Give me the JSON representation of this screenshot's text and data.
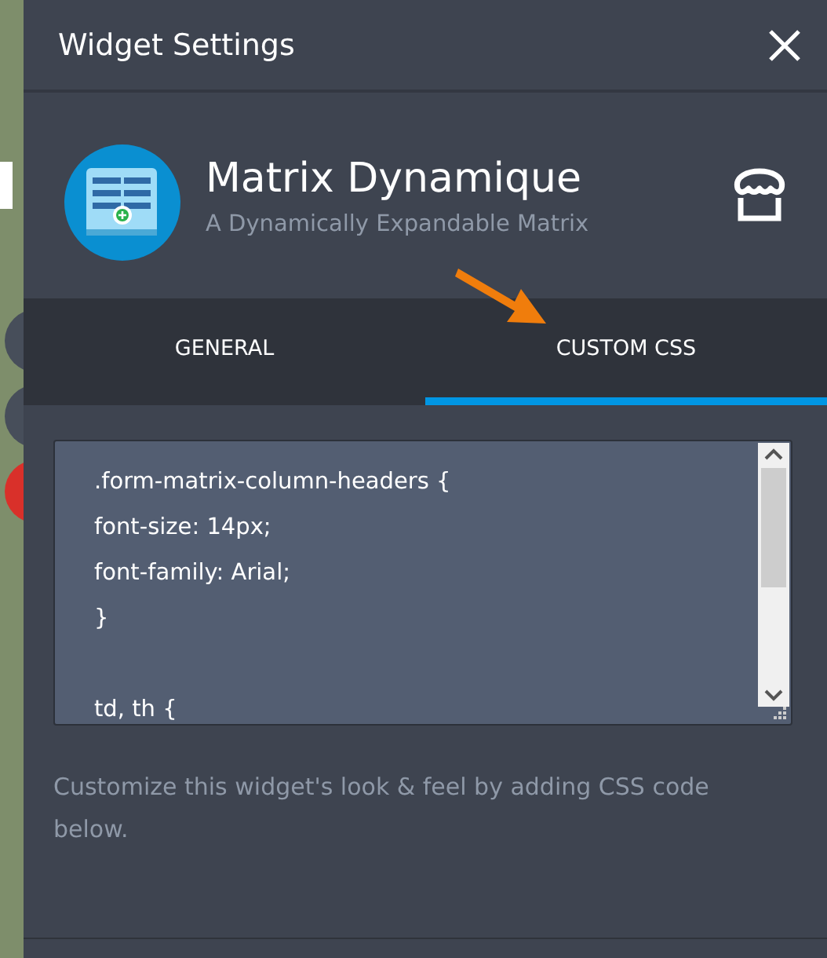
{
  "window": {
    "title": "Widget Settings"
  },
  "widget": {
    "name": "Matrix Dynamique",
    "description": "A Dynamically Expandable Matrix"
  },
  "tabs": [
    {
      "label": "GENERAL",
      "selected": false
    },
    {
      "label": "CUSTOM CSS",
      "selected": true
    }
  ],
  "css_editor": {
    "blocks": [
      {
        "lines": [
          ".form-matrix-column-headers {",
          "font-size: 14px;",
          "font-family: Arial;",
          "}"
        ]
      },
      {
        "lines": [
          "td, th {"
        ]
      }
    ]
  },
  "help_text": "Customize this widget's look & feel by adding CSS code below."
}
